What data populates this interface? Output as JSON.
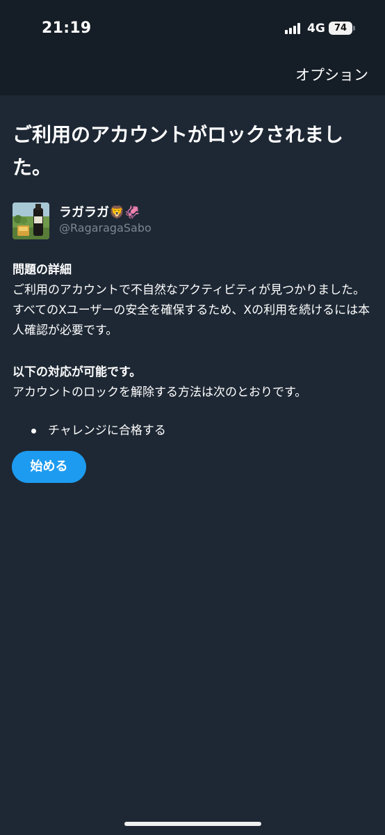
{
  "status_bar": {
    "time": "21:19",
    "network": "4G",
    "battery": "74"
  },
  "nav": {
    "options_label": "オプション"
  },
  "page": {
    "title": "ご利用のアカウントがロックされました。"
  },
  "account": {
    "display_name": "ラガラガ🦁🦑",
    "handle": "@RagaragaSabo"
  },
  "details": {
    "heading": "問題の詳細",
    "body": "ご利用のアカウントで不自然なアクティビティが見つかりました。すべてのXユーザーの安全を確保するため、Xの利用を続けるには本人確認が必要です。"
  },
  "actions": {
    "heading": "以下の対応が可能です。",
    "body": "アカウントのロックを解除する方法は次のとおりです。",
    "items": [
      "チャレンジに合格する"
    ]
  },
  "start_button": {
    "label": "始める"
  },
  "colors": {
    "background": "#1e2834",
    "header_background": "#151d26",
    "accent": "#1d9bf0",
    "secondary_text": "#7b8692"
  }
}
